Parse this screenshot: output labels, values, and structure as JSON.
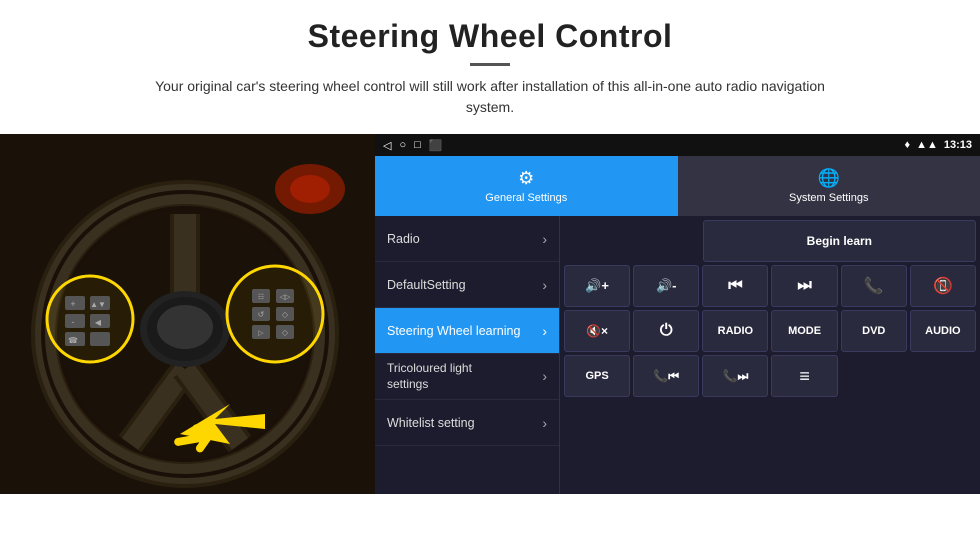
{
  "header": {
    "title": "Steering Wheel Control",
    "description": "Your original car's steering wheel control will still work after installation of this all-in-one auto radio navigation system."
  },
  "statusBar": {
    "navIcons": [
      "◁",
      "○",
      "□",
      "⬛"
    ],
    "rightIcons": [
      "signal",
      "wifi",
      "time"
    ],
    "time": "13:13"
  },
  "tabs": [
    {
      "id": "general",
      "label": "General Settings",
      "active": true
    },
    {
      "id": "system",
      "label": "System Settings",
      "active": false
    }
  ],
  "menuItems": [
    {
      "id": "radio",
      "label": "Radio",
      "active": false
    },
    {
      "id": "defaultsetting",
      "label": "DefaultSetting",
      "active": false
    },
    {
      "id": "steeringwheel",
      "label": "Steering Wheel learning",
      "active": true
    },
    {
      "id": "tricoloured",
      "label1": "Tricoloured light",
      "label2": "settings",
      "active": false,
      "multiline": true
    },
    {
      "id": "whitelist",
      "label": "Whitelist setting",
      "active": false
    }
  ],
  "controls": {
    "beginLearnLabel": "Begin learn",
    "buttons": [
      {
        "id": "vol-up",
        "symbol": "🔊+",
        "label": "VOL+"
      },
      {
        "id": "vol-down",
        "symbol": "🔊-",
        "label": "VOL-"
      },
      {
        "id": "prev-track",
        "symbol": "⏮",
        "label": "PREV"
      },
      {
        "id": "next-track",
        "symbol": "⏭",
        "label": "NEXT"
      },
      {
        "id": "phone",
        "symbol": "📞",
        "label": "CALL"
      },
      {
        "id": "hang-up",
        "symbol": "📵",
        "label": "HANGUP"
      },
      {
        "id": "mute",
        "symbol": "🔇×",
        "label": "MUTE"
      },
      {
        "id": "power",
        "symbol": "⏻",
        "label": "PWR"
      },
      {
        "id": "radio-btn",
        "symbol": "RADIO",
        "label": "RADIO"
      },
      {
        "id": "mode",
        "symbol": "MODE",
        "label": "MODE"
      },
      {
        "id": "dvd",
        "symbol": "DVD",
        "label": "DVD"
      },
      {
        "id": "audio",
        "symbol": "AUDIO",
        "label": "AUDIO"
      },
      {
        "id": "gps",
        "symbol": "GPS",
        "label": "GPS"
      },
      {
        "id": "phone-prev",
        "symbol": "📞⏮",
        "label": "TEL-PREV"
      },
      {
        "id": "phone-next",
        "symbol": "📞⏭",
        "label": "TEL-NEXT"
      },
      {
        "id": "list",
        "symbol": "≡",
        "label": "LIST"
      }
    ]
  }
}
